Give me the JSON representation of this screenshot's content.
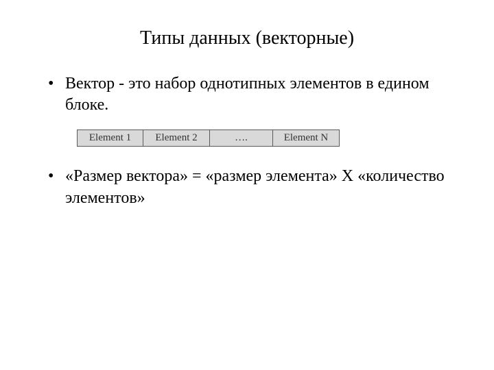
{
  "title": "Типы данных (векторные)",
  "bullets": {
    "b1": "Вектор  - это набор однотипных элементов в едином блоке.",
    "b2": "«Размер вектора» = «размер элемента» Х «количество элементов»"
  },
  "diagram": {
    "c1": "Element  1",
    "c2": "Element  2",
    "c3": "….",
    "c4": "Element  N"
  }
}
